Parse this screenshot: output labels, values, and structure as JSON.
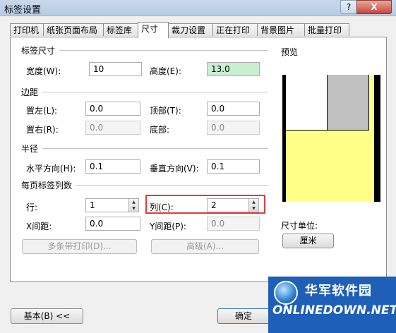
{
  "window": {
    "title": "标签设置",
    "help": "?",
    "close": "X"
  },
  "tabs": [
    "打印机",
    "纸张页面布局",
    "标签库",
    "尺寸",
    "裁刀设置",
    "正在打印",
    "背景图片",
    "批量打印"
  ],
  "active_tab": "尺寸",
  "label_size": {
    "section": "标签尺寸",
    "width_label": "宽度(W):",
    "width_value": "10",
    "height_label": "高度(E):",
    "height_value": "13.0"
  },
  "margins": {
    "section": "边距",
    "left_label": "置左(L):",
    "left_value": "0.0",
    "top_label": "顶部(T):",
    "top_value": "0.0",
    "right_label": "置右(R):",
    "right_value": "0.0",
    "bottom_label": "底部:",
    "bottom_value": "0.0"
  },
  "radius": {
    "section": "半径",
    "horizontal_label": "水平方向(H):",
    "horizontal_value": "0.1",
    "vertical_label": "垂直方向(V):",
    "vertical_value": "0.1"
  },
  "per_page": {
    "section": "每页标签列数",
    "rows_label": "行:",
    "rows_value": "1",
    "cols_label": "列(C):",
    "cols_value": "2",
    "xgap_label": "X间距:",
    "xgap_value": "0.0",
    "ygap_label": "Y间距(P):",
    "ygap_value": "0.0",
    "multi_print_button": "多条带打印(D)...",
    "advanced_button": "高级(A)..."
  },
  "preview": {
    "section": "预览",
    "unit_label": "尺寸单位:",
    "unit_button": "厘米"
  },
  "footer": {
    "basic_button": "基本(B) <<",
    "ok_button": "确定"
  },
  "watermark": {
    "line1": "华军软件园",
    "line2": "ONLINEDOWN.NET"
  },
  "colors": {
    "preview_yellow": "#ffff88",
    "highlight": "#e33a3a",
    "watermark_blue": "#1e5fb8"
  }
}
